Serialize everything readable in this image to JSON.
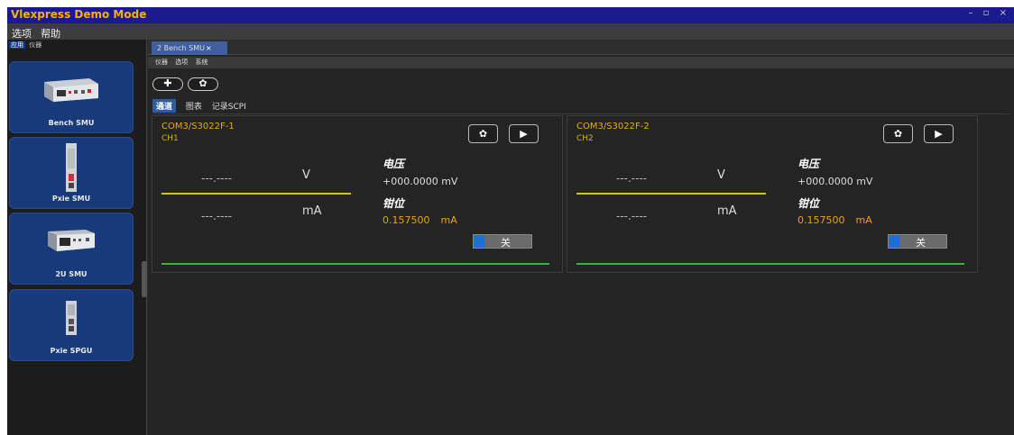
{
  "window": {
    "title": "Vlexpress Demo Mode",
    "controls": "– ▫ ×"
  },
  "menubar": {
    "items": [
      "选项",
      "帮助"
    ]
  },
  "leftpanel": {
    "tabs": [
      "应用",
      "仪器"
    ],
    "devices": [
      {
        "label": "Bench SMU"
      },
      {
        "label": "Pxie SMU"
      },
      {
        "label": "2U SMU"
      },
      {
        "label": "Pxie SPGU"
      }
    ]
  },
  "document": {
    "tab_label": "2 Bench SMU",
    "tab_close": "×",
    "submenu": [
      "仪器",
      "选项",
      "系统"
    ],
    "add_button": "✚",
    "settings_button": "✿",
    "content_tabs": [
      "通道",
      "图表",
      "记录SCPI"
    ],
    "active_tab": "通道"
  },
  "channels": [
    {
      "address": "COM3/S3022F-1",
      "name": "CH1",
      "voltage_reading": "---.----",
      "voltage_unit": "V",
      "current_reading": "---.----",
      "current_unit": "mA",
      "voltage_label": "电压",
      "voltage_setpoint": "+000.0000 mV",
      "clamp_label": "钳位",
      "clamp_value": "0.157500",
      "clamp_unit": "mA",
      "output_state": "关",
      "settings_icon": "✿",
      "run_icon": "▶"
    },
    {
      "address": "COM3/S3022F-2",
      "name": "CH2",
      "voltage_reading": "---.----",
      "voltage_unit": "V",
      "current_reading": "---.----",
      "current_unit": "mA",
      "voltage_label": "电压",
      "voltage_setpoint": "+000.0000 mV",
      "clamp_label": "钳位",
      "clamp_value": "0.157500",
      "clamp_unit": "mA",
      "output_state": "关",
      "settings_icon": "✿",
      "run_icon": "▶"
    }
  ],
  "colors": {
    "titlebar": "#1a1a8c",
    "title_text": "#ffb000",
    "device_card": "#173a7a",
    "channel_text": "#e2b000",
    "clamp_value": "#f0a000",
    "status_line": "#2bc02b",
    "toggle_knob": "#1f6ed4"
  }
}
